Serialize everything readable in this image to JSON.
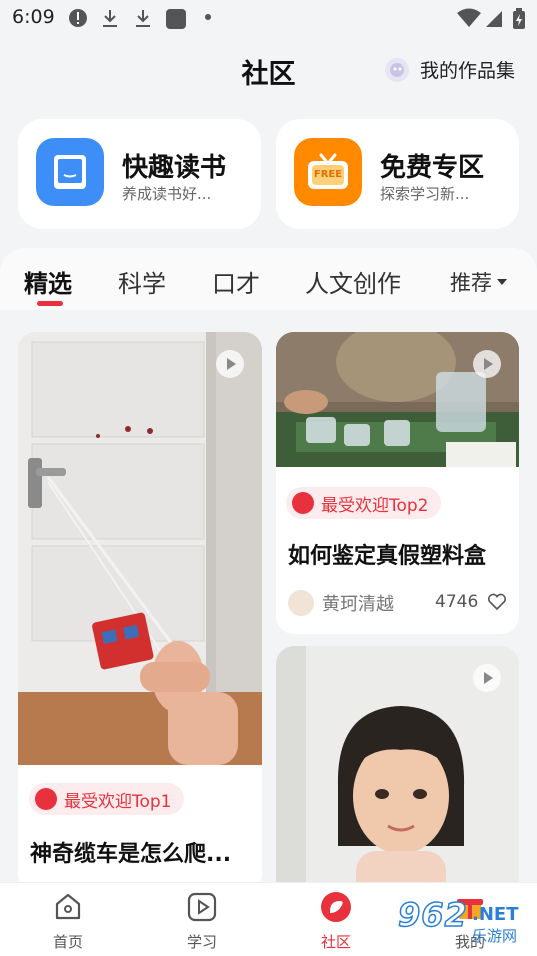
{
  "status_bar": {
    "time": "6:09"
  },
  "header": {
    "title": "社区",
    "works_label": "我的作品集"
  },
  "promos": [
    {
      "title": "快趣读书",
      "subtitle": "养成读书好...",
      "icon": "book-icon",
      "color": "#3e8ef7"
    },
    {
      "title": "免费专区",
      "subtitle": "探索学习新...",
      "icon": "free-tv-icon",
      "color": "#ff8a00",
      "icon_text": "FREE"
    }
  ],
  "tabs": [
    "精选",
    "科学",
    "口才",
    "人文创作"
  ],
  "active_tab": "精选",
  "recommend_label": "推荐",
  "cards": [
    {
      "badge": "最受欢迎Top1",
      "title": "神奇缆车是怎么爬..."
    },
    {
      "badge": "最受欢迎Top2",
      "title": "如何鉴定真假塑料盒",
      "author": "黄珂清越",
      "likes": "4746"
    }
  ],
  "bottom_nav": [
    {
      "label": "首页",
      "icon": "home-icon"
    },
    {
      "label": "学习",
      "icon": "play-square-icon"
    },
    {
      "label": "社区",
      "icon": "community-icon",
      "active": true
    },
    {
      "label": "我的",
      "icon": "gift-icon"
    }
  ],
  "watermark": {
    "number": "962",
    "suffix": ".NET",
    "site": "乐游网"
  },
  "colors": {
    "accent": "#e8313c",
    "background": "#f3f4f6"
  }
}
